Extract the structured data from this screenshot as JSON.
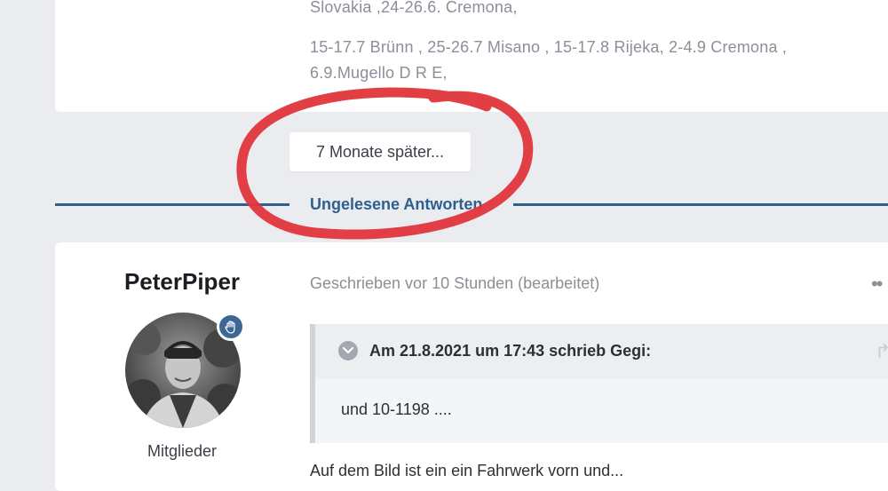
{
  "previous_post": {
    "lines": [
      "Slovakia ,24-26.6. Cremona,",
      "15-17.7 Brünn , 25-26.7 Misano , 15-17.8 Rijeka, 2-4.9 Cremona ,",
      "6.9.Mugello D R E,"
    ]
  },
  "time_gap": {
    "label": "7 Monate später..."
  },
  "unread_separator": {
    "label": "Ungelesene Antworten"
  },
  "post": {
    "author": {
      "name": "PeterPiper",
      "group": "Mitglieder",
      "badge_icon": "raised-hand-icon"
    },
    "meta": "Geschrieben vor 10 Stunden (bearbeitet)",
    "menu_icon": "more-dots-icon",
    "quote": {
      "citation": "Am 21.8.2021 um 17:43 schrieb Gegi:",
      "body": "und 10-1198 ....",
      "toggle_icon": "chevron-down-icon",
      "share_icon": "share-arrow-icon"
    },
    "body_peek": "Auf dem Bild ist ein ein Fahrwerk vorn und..."
  },
  "colors": {
    "page_bg": "#ebecf0",
    "accent": "#2f5f8f",
    "annotation_red": "#e0353b"
  }
}
